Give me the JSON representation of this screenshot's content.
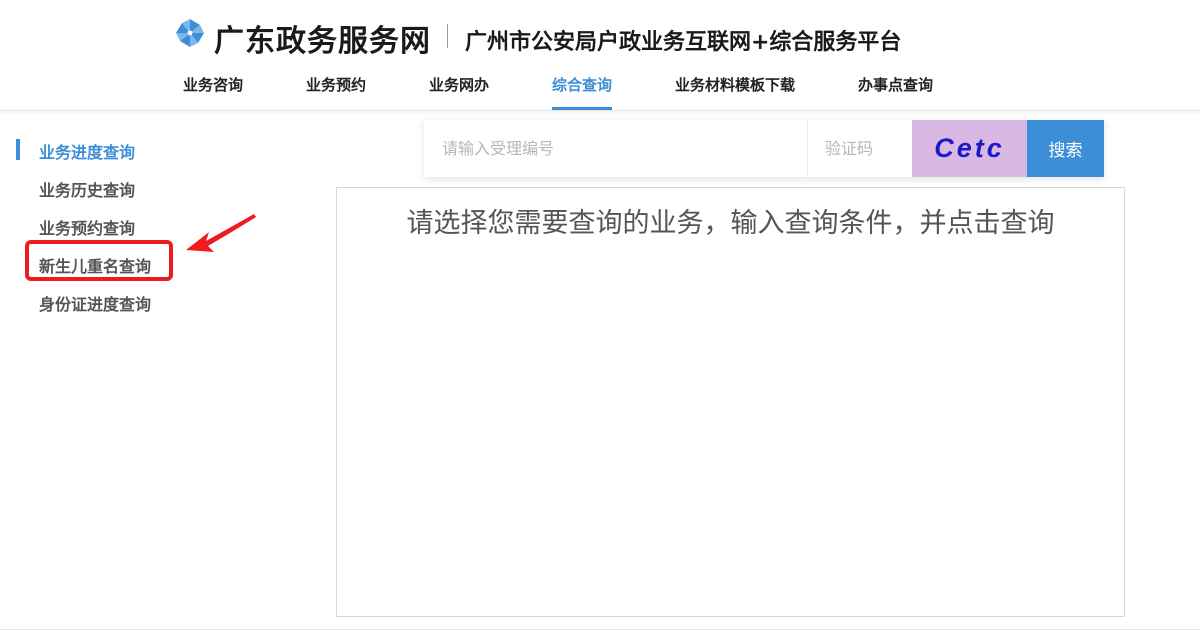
{
  "header": {
    "site_name": "广东政务服务网",
    "platform_name": "广州市公安局户政业务互联网+综合服务平台",
    "logo_icon": "pinwheel-logo-icon",
    "accent_color": "#3c8fd6"
  },
  "nav": {
    "items": [
      {
        "label": "业务咨询",
        "active": false
      },
      {
        "label": "业务预约",
        "active": false
      },
      {
        "label": "业务网办",
        "active": false
      },
      {
        "label": "综合查询",
        "active": true
      },
      {
        "label": "业务材料模板下载",
        "active": false
      },
      {
        "label": "办事点查询",
        "active": false
      }
    ]
  },
  "sidebar": {
    "items": [
      {
        "label": "业务进度查询",
        "active": true
      },
      {
        "label": "业务历史查询",
        "active": false
      },
      {
        "label": "业务预约查询",
        "active": false
      },
      {
        "label": "新生儿重名查询",
        "active": false,
        "highlighted": true
      },
      {
        "label": "身份证进度查询",
        "active": false
      }
    ]
  },
  "search": {
    "acceptance_placeholder": "请输入受理编号",
    "acceptance_value": "",
    "captcha_placeholder": "验证码",
    "captcha_value": "",
    "captcha_image_text": "Cetc",
    "button_label": "搜索"
  },
  "result": {
    "message": "请选择您需要查询的业务，输入查询条件，并点击查询"
  },
  "annotation": {
    "highlight_color": "#ee1c1c",
    "arrow_icon": "red-arrow-icon"
  }
}
